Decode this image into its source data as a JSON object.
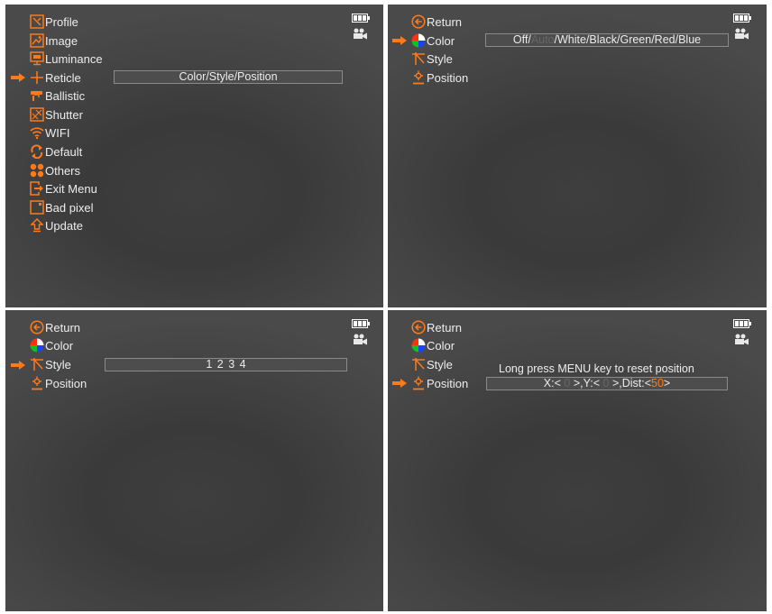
{
  "colors": {
    "accent": "#ff7a18",
    "text": "#ededed",
    "panel_bg": "#3c3c3c",
    "value_box_bg": "#4d4d4d",
    "value_box_border": "#8a8a8a"
  },
  "status": {
    "battery_icon": "battery-full-icon",
    "camera_icon": "video-camera-icon"
  },
  "main_menu": {
    "items": [
      {
        "label": "Profile",
        "icon": "profile-icon"
      },
      {
        "label": "Image",
        "icon": "image-icon"
      },
      {
        "label": "Luminance",
        "icon": "luminance-icon"
      },
      {
        "label": "Reticle",
        "icon": "reticle-icon"
      },
      {
        "label": "Ballistic",
        "icon": "ballistic-icon"
      },
      {
        "label": "Shutter",
        "icon": "shutter-icon"
      },
      {
        "label": "WIFI",
        "icon": "wifi-icon"
      },
      {
        "label": "Default",
        "icon": "default-icon"
      },
      {
        "label": "Others",
        "icon": "others-icon"
      },
      {
        "label": "Exit Menu",
        "icon": "exit-icon"
      },
      {
        "label": "Bad pixel",
        "icon": "bad-pixel-icon"
      },
      {
        "label": "Update",
        "icon": "update-icon"
      }
    ],
    "selected_index": 3,
    "selected_value": "Color/Style/Position"
  },
  "reticle_menu": {
    "items": [
      {
        "label": "Return",
        "icon": "return-icon"
      },
      {
        "label": "Color",
        "icon": "color-wheel-icon"
      },
      {
        "label": "Style",
        "icon": "style-icon"
      },
      {
        "label": "Position",
        "icon": "position-icon"
      }
    ]
  },
  "color_screen": {
    "selected_index": 1,
    "options_before": "Off/",
    "options_selected": "Auto",
    "options_after": "/White/Black/Green/Red/Blue"
  },
  "style_screen": {
    "selected_index": 2,
    "value": "1 2 3 4"
  },
  "position_screen": {
    "selected_index": 3,
    "hint": "Long press MENU key to reset position",
    "x_prefix": "X:<",
    "x_value": "0",
    "y_prefix": ">,Y:<",
    "y_value": "0",
    "dist_prefix": ">,Dist:<",
    "dist_value": "50",
    "suffix": ">"
  }
}
